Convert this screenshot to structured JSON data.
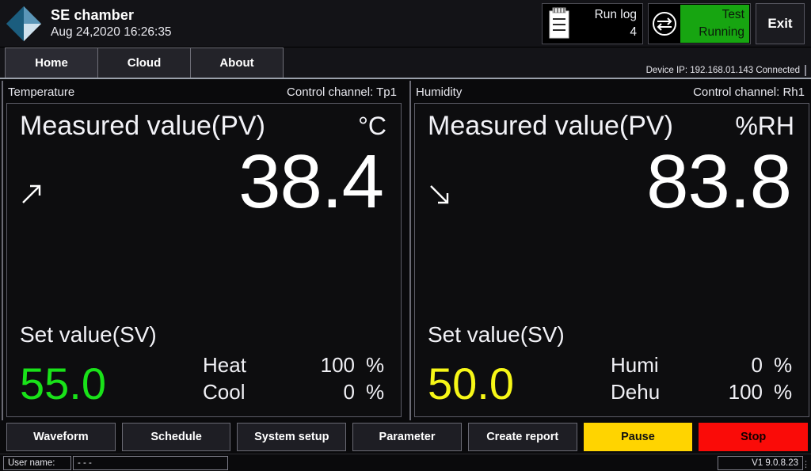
{
  "header": {
    "logo_icon": "diamond-logo-icon",
    "app_title": "SE chamber",
    "datetime": "Aug 24,2020 16:26:35",
    "run_log": {
      "icon": "clipboard-icon",
      "label": "Run log",
      "count": "4"
    },
    "status": {
      "icon": "exchange-arrows-icon",
      "line1": "Test",
      "line2": "Running",
      "color": "#17a511"
    },
    "exit_label": "Exit"
  },
  "tabs": [
    {
      "label": "Home",
      "active": true
    },
    {
      "label": "Cloud",
      "active": false
    },
    {
      "label": "About",
      "active": false
    }
  ],
  "device_info": "Device IP: 192.168.01.143  Connected",
  "panels": [
    {
      "title": "Temperature",
      "channel": "Control channel: Tp1",
      "pv_label": "Measured value(PV)",
      "unit": "°C",
      "trend_icon": "arrow-up-right-icon",
      "pv_value": "38.4",
      "sv_label": "Set value(SV)",
      "sv_value": "55.0",
      "sv_color": "#19e219",
      "outputs": [
        {
          "name": "Heat",
          "value": "100",
          "pct": "%"
        },
        {
          "name": "Cool",
          "value": "0",
          "pct": "%"
        }
      ]
    },
    {
      "title": "Humidity",
      "channel": "Control channel: Rh1",
      "pv_label": "Measured value(PV)",
      "unit": "%RH",
      "trend_icon": "arrow-down-right-icon",
      "pv_value": "83.8",
      "sv_label": "Set value(SV)",
      "sv_value": "50.0",
      "sv_color": "#f7f717",
      "outputs": [
        {
          "name": "Humi",
          "value": "0",
          "pct": "%"
        },
        {
          "name": "Dehu",
          "value": "100",
          "pct": "%"
        }
      ]
    }
  ],
  "buttons": [
    {
      "label": "Waveform",
      "style": "default"
    },
    {
      "label": "Schedule",
      "style": "default"
    },
    {
      "label": "System setup",
      "style": "default"
    },
    {
      "label": "Parameter",
      "style": "default"
    },
    {
      "label": "Create report",
      "style": "default"
    },
    {
      "label": "Pause",
      "style": "pause"
    },
    {
      "label": "Stop",
      "style": "stop"
    }
  ],
  "statusbar": {
    "user_label": "User name:",
    "user_value": "- - -",
    "version": "V1  9.0.8.23"
  }
}
